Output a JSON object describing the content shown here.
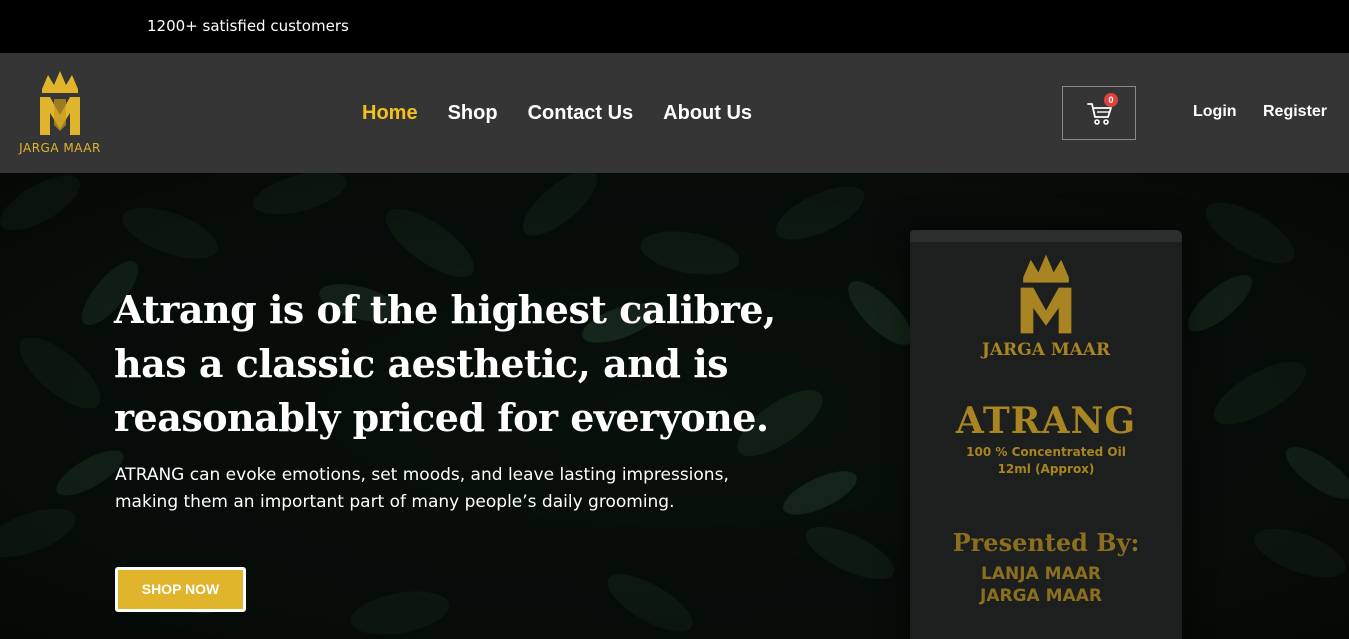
{
  "topbar": {
    "text": "1200+ satisfied customers"
  },
  "header": {
    "logo_text": "JARGA MAAR",
    "nav": [
      {
        "label": "Home",
        "active": true
      },
      {
        "label": "Shop",
        "active": false
      },
      {
        "label": "Contact Us",
        "active": false
      },
      {
        "label": "About Us",
        "active": false
      }
    ],
    "cart": {
      "icon": "cart-icon",
      "count": "0"
    },
    "login_label": "Login",
    "register_label": "Register"
  },
  "hero": {
    "headline_lines": [
      "Atrang is of the highest calibre,",
      "has a classic aesthetic, and is",
      "reasonably priced for everyone."
    ],
    "subtext_lines": [
      "ATRANG can evoke emotions, set moods, and leave lasting impressions,",
      "making them an important part of many people’s daily grooming."
    ],
    "cta_label": "SHOP NOW",
    "product": {
      "brand": "JARGA MAAR",
      "name": "ATRANG",
      "sub1": "100 % Concentrated Oil",
      "sub2": "12ml (Approx)",
      "presented": "Presented By:",
      "line1": "LANJA MAAR",
      "line2": "JARGA MAAR"
    }
  },
  "colors": {
    "accent": "#e0b52b",
    "nav_active": "#f2c11f",
    "header_bg": "#353535",
    "topbar_bg": "#000000",
    "badge": "#e0413d"
  }
}
